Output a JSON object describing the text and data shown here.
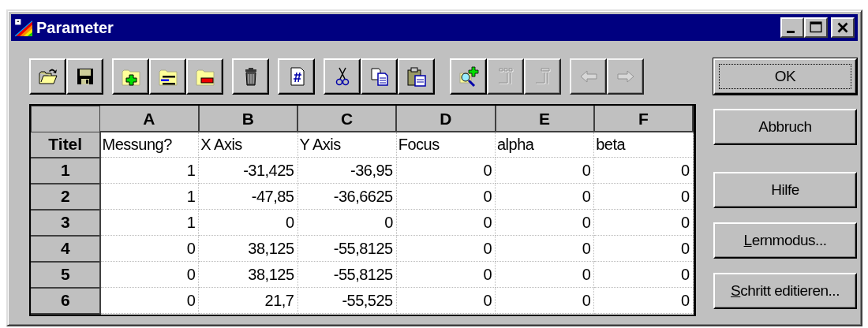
{
  "window": {
    "title": "Parameter",
    "controls": [
      {
        "kind": "minimize"
      },
      {
        "kind": "maximize"
      },
      {
        "kind": "close"
      }
    ]
  },
  "toolbar": [
    [
      {
        "kind": "open",
        "disabled": false
      },
      {
        "kind": "save",
        "disabled": false
      }
    ],
    [
      {
        "kind": "add-row",
        "disabled": false
      },
      {
        "kind": "insert-row",
        "disabled": false
      },
      {
        "kind": "delete-row",
        "disabled": false
      }
    ],
    [
      {
        "kind": "delete",
        "disabled": false
      }
    ],
    [
      {
        "kind": "number",
        "disabled": false
      }
    ],
    [
      {
        "kind": "cut",
        "disabled": false
      },
      {
        "kind": "copy",
        "disabled": false
      },
      {
        "kind": "paste",
        "disabled": false
      }
    ],
    [
      {
        "kind": "zoom-add",
        "disabled": false
      },
      {
        "kind": "columns",
        "disabled": true
      },
      {
        "kind": "column",
        "disabled": true
      }
    ],
    [
      {
        "kind": "back",
        "disabled": true
      },
      {
        "kind": "forward",
        "disabled": true
      }
    ]
  ],
  "table": {
    "columns": [
      "A",
      "B",
      "C",
      "D",
      "E",
      "F"
    ],
    "title_row": {
      "label": "Titel",
      "cells": [
        "Messung?",
        "X Axis",
        "Y Axis",
        "Focus",
        "alpha",
        "beta"
      ]
    },
    "rows": [
      {
        "label": "1",
        "cells": [
          "1",
          "-31,425",
          "-36,95",
          "0",
          "0",
          "0"
        ]
      },
      {
        "label": "2",
        "cells": [
          "1",
          "-47,85",
          "-36,6625",
          "0",
          "0",
          "0"
        ]
      },
      {
        "label": "3",
        "cells": [
          "1",
          "0",
          "0",
          "0",
          "0",
          "0"
        ]
      },
      {
        "label": "4",
        "cells": [
          "0",
          "38,125",
          "-55,8125",
          "0",
          "0",
          "0"
        ]
      },
      {
        "label": "5",
        "cells": [
          "0",
          "38,125",
          "-55,8125",
          "0",
          "0",
          "0"
        ]
      },
      {
        "label": "6",
        "cells": [
          "0",
          "21,7",
          "-55,525",
          "0",
          "0",
          "0"
        ]
      }
    ]
  },
  "buttons": [
    {
      "label": "OK",
      "default": true,
      "underline_first": false
    },
    {
      "label": "Abbruch",
      "default": false,
      "underline_first": false
    },
    {
      "label": "Hilfe",
      "default": false,
      "underline_first": false
    },
    {
      "label": "Lernmodus...",
      "default": false,
      "underline_first": true
    },
    {
      "label": "Schritt editieren...",
      "default": false,
      "underline_first": true
    }
  ]
}
